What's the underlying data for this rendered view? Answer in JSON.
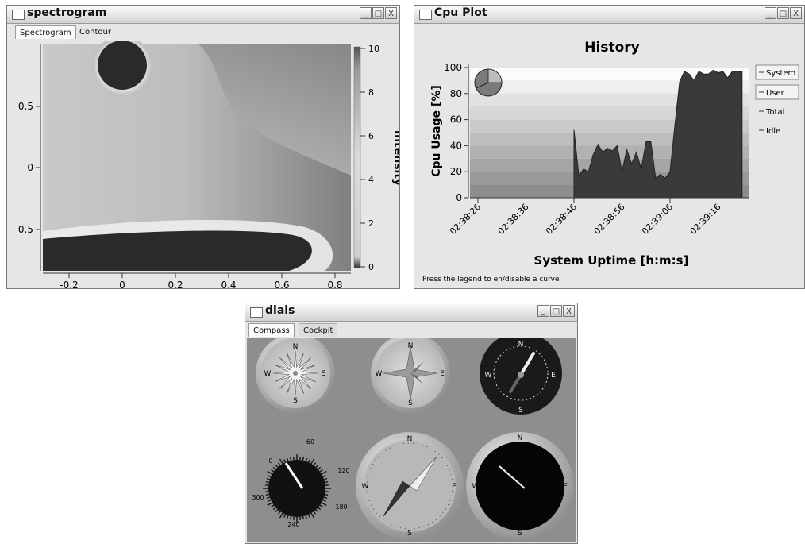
{
  "spectrogram": {
    "title": "spectrogram",
    "tabs": [
      "Spectrogram",
      "Contour"
    ],
    "x_ticks": [
      "-0.2",
      "0",
      "0.2",
      "0.4",
      "0.6",
      "0.8"
    ],
    "y_ticks": [
      "0.5",
      "0",
      "-0.5"
    ],
    "colorbar_ticks": [
      "10",
      "8",
      "6",
      "4",
      "2",
      "0"
    ],
    "colorbar_label": "Intensity"
  },
  "cpu_plot": {
    "title": "Cpu Plot",
    "chart_title": "History",
    "ylabel": "Cpu Usage [%]",
    "xlabel": "System Uptime [h:m:s]",
    "y_ticks": [
      "100",
      "80",
      "60",
      "40",
      "20",
      "0"
    ],
    "x_ticks": [
      "02:38:26",
      "02:38:36",
      "02:38:46",
      "02:38:56",
      "02:39:06",
      "02:39:16"
    ],
    "legend": [
      "System",
      "User",
      "Total",
      "Idle"
    ],
    "status": "Press the legend to en/disable a curve"
  },
  "dials": {
    "title": "dials",
    "tabs": [
      "Compass",
      "Cockpit"
    ],
    "cardinal": [
      "N",
      "E",
      "S",
      "W"
    ],
    "knob_labels": [
      "0",
      "60",
      "120",
      "180",
      "240",
      "300"
    ]
  },
  "window_buttons": [
    "_",
    "□",
    "X"
  ],
  "chart_data": {
    "type": "area",
    "title": "History",
    "xlabel": "System Uptime [h:m:s]",
    "ylabel": "Cpu Usage [%]",
    "ylim": [
      0,
      100
    ],
    "x": [
      "02:38:46",
      "02:38:47",
      "02:38:48",
      "02:38:49",
      "02:38:50",
      "02:38:51",
      "02:38:52",
      "02:38:53",
      "02:38:54",
      "02:38:55",
      "02:38:56",
      "02:38:57",
      "02:38:58",
      "02:38:59",
      "02:39:00",
      "02:39:01",
      "02:39:02",
      "02:39:03",
      "02:39:04",
      "02:39:05",
      "02:39:06",
      "02:39:07",
      "02:39:08",
      "02:39:09",
      "02:39:10",
      "02:39:11",
      "02:39:12",
      "02:39:13",
      "02:39:14",
      "02:39:15",
      "02:39:16",
      "02:39:17",
      "02:39:18",
      "02:39:19",
      "02:39:20",
      "02:39:21"
    ],
    "series": [
      {
        "values": [
          52,
          17,
          22,
          20,
          33,
          41,
          35,
          38,
          36,
          40,
          20,
          37,
          26,
          35,
          22,
          43,
          43,
          15,
          18,
          15,
          20,
          55,
          89,
          97,
          95,
          90,
          97,
          95,
          95,
          98,
          96,
          97,
          92,
          97,
          97,
          97
        ]
      }
    ]
  }
}
